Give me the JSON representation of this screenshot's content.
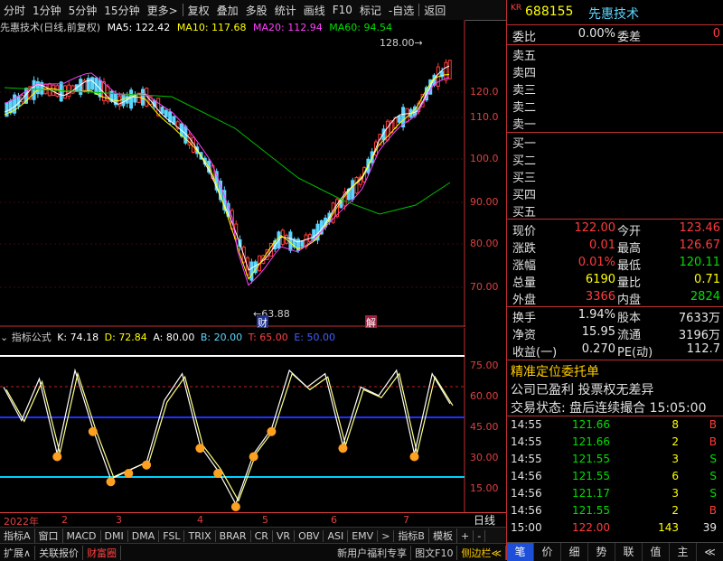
{
  "toolbar": {
    "items": [
      "分时",
      "1分钟",
      "5分钟",
      "15分钟",
      "更多>",
      "复权",
      "叠加",
      "多股",
      "统计",
      "画线",
      "F10",
      "标记",
      "-自选",
      "返回"
    ]
  },
  "main_chart": {
    "title": "先惠技术(日线,前复权)",
    "ma5": "MA5: 122.42",
    "ma10": "MA10: 117.68",
    "ma20": "MA20: 112.94",
    "ma60": "MA60: 94.54",
    "high_label": "128.00",
    "low_label": "63.88",
    "y_ticks": [
      "120.0",
      "110.0",
      "100.0",
      "90.00",
      "80.00",
      "70.00"
    ],
    "marker_cai": "财",
    "marker_jie": "解"
  },
  "indicator": {
    "name": "指标公式",
    "k": "K: 74.18",
    "d": "D: 72.84",
    "a": "A: 80.00",
    "b": "B: 20.00",
    "t": "T: 65.00",
    "e": "E: 50.00",
    "y_ticks": [
      "75.00",
      "60.00",
      "45.00",
      "30.00",
      "15.00"
    ],
    "wave_values": [
      70,
      50,
      75,
      30,
      80,
      45,
      15,
      20,
      25,
      62,
      78,
      35,
      20,
      0,
      30,
      45,
      80,
      70,
      78,
      35,
      70,
      65,
      80,
      30,
      78,
      60
    ]
  },
  "dates": [
    "2022年",
    "2",
    "3",
    "4",
    "5",
    "6",
    "7"
  ],
  "date_axis_right": "日线",
  "indicator_tabs": [
    "指标A",
    "窗口",
    "MACD",
    "DMI",
    "DMA",
    "FSL",
    "TRIX",
    "BRAR",
    "CR",
    "VR",
    "OBV",
    "ASI",
    "EMV",
    ">",
    "指标B",
    "模板",
    "+",
    "-"
  ],
  "bottom_tabs": [
    "扩展∧",
    "关联报价",
    "财富圈"
  ],
  "bottom_right": [
    "新用户福利专享",
    "图文F10",
    "侧边栏≪"
  ],
  "quote": {
    "kr": "KR",
    "code": "688155",
    "name": "先惠技术",
    "weibi_label": "委比",
    "weibi_value": "0.00%",
    "weicha_label": "委差",
    "weicha_value": "0",
    "sell": [
      "卖五",
      "卖四",
      "卖三",
      "卖二",
      "卖一"
    ],
    "buy": [
      "买一",
      "买二",
      "买三",
      "买四",
      "买五"
    ],
    "rows": [
      {
        "l": "现价",
        "v": "122.00",
        "vc": "red",
        "l2": "今开",
        "v2": "123.46",
        "v2c": "red"
      },
      {
        "l": "涨跌",
        "v": "0.01",
        "vc": "red",
        "l2": "最高",
        "v2": "126.67",
        "v2c": "red"
      },
      {
        "l": "涨幅",
        "v": "0.01%",
        "vc": "red",
        "l2": "最低",
        "v2": "120.11",
        "v2c": "green"
      },
      {
        "l": "总量",
        "v": "6190",
        "vc": "yellow",
        "l2": "量比",
        "v2": "0.71",
        "v2c": "yellow"
      },
      {
        "l": "外盘",
        "v": "3366",
        "vc": "red",
        "l2": "内盘",
        "v2": "2824",
        "v2c": "green"
      }
    ],
    "rows2": [
      {
        "l": "换手",
        "v": "1.94%",
        "l2": "股本",
        "v2": "7633万"
      },
      {
        "l": "净资",
        "v": "15.95",
        "l2": "流通",
        "v2": "3196万"
      },
      {
        "l": "收益(一)",
        "v": "0.270",
        "l2": "PE(动)",
        "v2": "112.7"
      }
    ],
    "notice1": "精准定位委托单",
    "notice2": "公司已盈利 投票权无差异",
    "status": "交易状态: 盘后连续撮合 15:05:00",
    "ticks": [
      {
        "t": "14:55",
        "p": "121.66",
        "pc": "green",
        "v": "8",
        "s": "B",
        "sc": "red"
      },
      {
        "t": "14:55",
        "p": "121.66",
        "pc": "green",
        "v": "2",
        "s": "B",
        "sc": "red"
      },
      {
        "t": "14:55",
        "p": "121.55",
        "pc": "green",
        "v": "3",
        "s": "S",
        "sc": "green"
      },
      {
        "t": "14:56",
        "p": "121.55",
        "pc": "green",
        "v": "6",
        "s": "S",
        "sc": "green"
      },
      {
        "t": "14:56",
        "p": "121.17",
        "pc": "green",
        "v": "3",
        "s": "S",
        "sc": "green"
      },
      {
        "t": "14:56",
        "p": "121.55",
        "pc": "green",
        "v": "2",
        "s": "B",
        "sc": "red"
      },
      {
        "t": "15:00",
        "p": "122.00",
        "pc": "red",
        "v": "143",
        "s": "39",
        "sc": "white"
      }
    ],
    "tabs": [
      "笔",
      "价",
      "细",
      "势",
      "联",
      "值",
      "主",
      "≪"
    ]
  },
  "colors": {
    "bg": "#000000",
    "up": "#ff3c3c",
    "down": "#5cd6ff",
    "ma5": "#ffffff",
    "ma10": "#ffff00",
    "ma20": "#ff40ff",
    "ma60": "#00e000"
  }
}
